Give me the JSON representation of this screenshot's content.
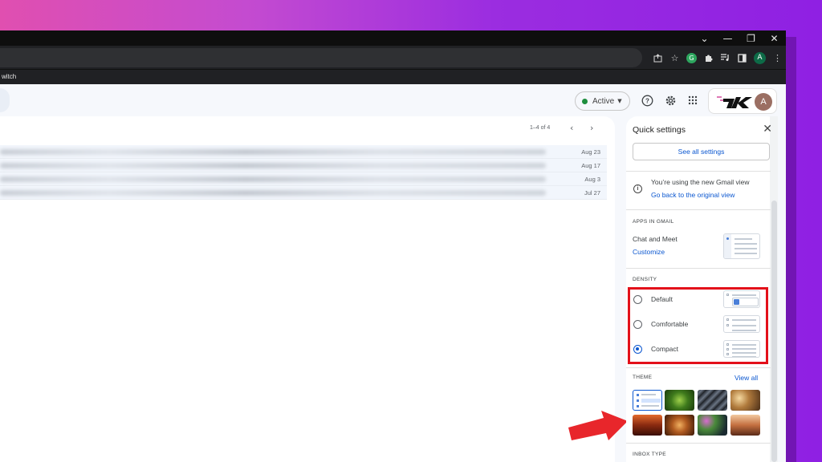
{
  "browser": {
    "bookmark_fragment": "witch",
    "window_controls": [
      "⌄",
      "—",
      "❐",
      "✕"
    ],
    "extensions": [
      "share-icon",
      "star-icon",
      "grammarly-icon",
      "puzzle-icon",
      "media-icon",
      "sidebar-icon",
      "A",
      "⋮"
    ],
    "profile_letter": "A"
  },
  "header": {
    "status_label": "Active",
    "status_color": "#1e8e3e",
    "help_icon": "?",
    "settings_icon": "⚙",
    "apps_icon": "⋮⋮⋮",
    "avatar_letter": "A",
    "avatar_color": "#9b6f63"
  },
  "mail": {
    "pager_text": "1–4 of 4",
    "pager_prev": "‹",
    "pager_next": "›",
    "rows": [
      {
        "date": "Aug 23"
      },
      {
        "date": "Aug 17"
      },
      {
        "date": "Aug 3"
      },
      {
        "date": "Jul 27"
      }
    ]
  },
  "quick_settings": {
    "title": "Quick settings",
    "close": "✕",
    "see_all": "See all settings",
    "new_view_text": "You’re using the new Gmail view",
    "go_back_link": "Go back to the original view",
    "apps_heading": "APPS IN GMAIL",
    "apps_item": "Chat and Meet",
    "customize_link": "Customize",
    "density_heading": "DENSITY",
    "density_options": [
      {
        "label": "Default",
        "selected": false
      },
      {
        "label": "Comfortable",
        "selected": false
      },
      {
        "label": "Compact",
        "selected": true
      }
    ],
    "theme_heading": "THEME",
    "view_all_link": "View all",
    "inbox_heading": "INBOX TYPE",
    "highlight_color": "#e3101a",
    "accent_color": "#0b57d0"
  }
}
